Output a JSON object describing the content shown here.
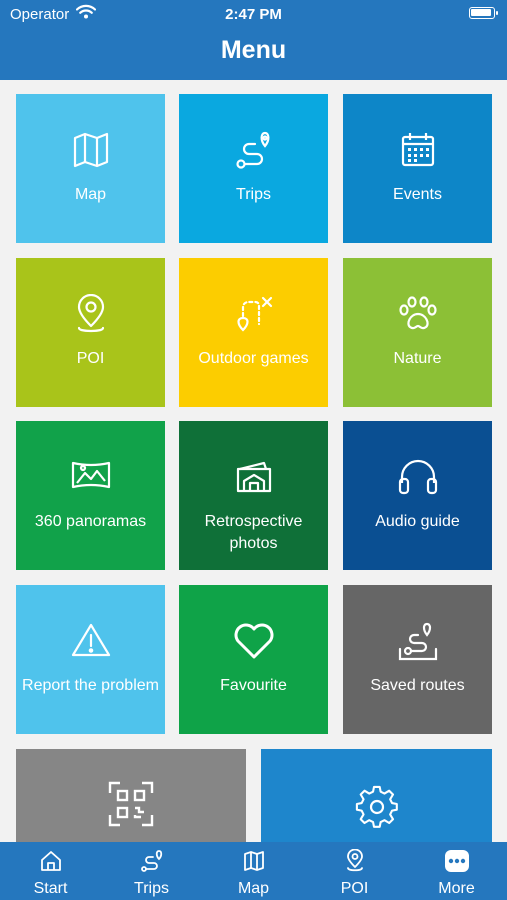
{
  "status_bar": {
    "carrier": "Operator",
    "time": "2:47 PM"
  },
  "header": {
    "title": "Menu"
  },
  "tiles": [
    {
      "label": "Map",
      "icon": "map-icon",
      "color": "#4fc3ec"
    },
    {
      "label": "Trips",
      "icon": "route-icon",
      "color": "#0aa8e0"
    },
    {
      "label": "Events",
      "icon": "calendar-icon",
      "color": "#0d86c8"
    },
    {
      "label": "POI",
      "icon": "location-pin-icon",
      "color": "#a9c41a"
    },
    {
      "label": "Outdoor games",
      "icon": "treasure-path-icon",
      "color": "#fccd00"
    },
    {
      "label": "Nature",
      "icon": "paw-icon",
      "color": "#8cc036"
    },
    {
      "label": "360 panoramas",
      "icon": "panorama-icon",
      "color": "#11a24a"
    },
    {
      "label": "Retrospective photos",
      "icon": "photo-icon",
      "color": "#0f7038"
    },
    {
      "label": "Audio guide",
      "icon": "headphones-icon",
      "color": "#0a4f92"
    },
    {
      "label": "Report the problem",
      "icon": "warning-icon",
      "color": "#4fc3ec"
    },
    {
      "label": "Favourite",
      "icon": "heart-icon",
      "color": "#0fa348"
    },
    {
      "label": "Saved routes",
      "icon": "saved-route-icon",
      "color": "#666666"
    },
    {
      "label": "",
      "icon": "qr-code-icon",
      "color": "#868686"
    },
    {
      "label": "",
      "icon": "gear-icon",
      "color": "#1e86cc"
    }
  ],
  "tabs": [
    {
      "label": "Start",
      "icon": "home-icon"
    },
    {
      "label": "Trips",
      "icon": "route-icon"
    },
    {
      "label": "Map",
      "icon": "map-icon"
    },
    {
      "label": "POI",
      "icon": "location-pin-icon"
    },
    {
      "label": "More",
      "icon": "more-icon"
    }
  ]
}
